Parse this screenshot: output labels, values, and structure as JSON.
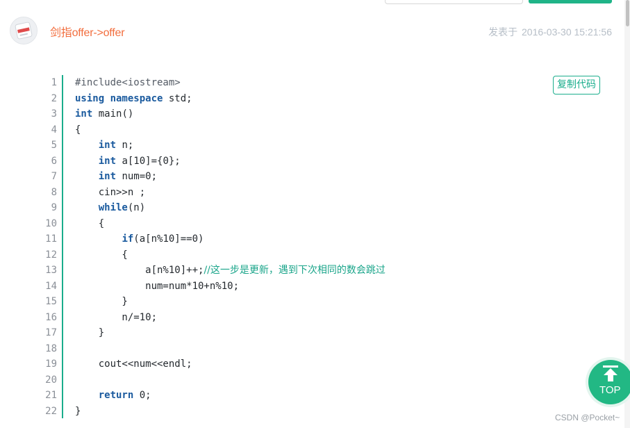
{
  "post": {
    "title": "剑指offer->offer",
    "time_prefix": "发表于",
    "timestamp": "2016-03-30 15:21:56"
  },
  "code": {
    "copy_label": "复制代码",
    "line_numbers": [
      "1",
      "2",
      "3",
      "4",
      "5",
      "6",
      "7",
      "8",
      "9",
      "10",
      "11",
      "12",
      "13",
      "14",
      "15",
      "16",
      "17",
      "18",
      "19",
      "20",
      "21",
      "22"
    ],
    "lines": [
      [
        {
          "t": "#include<iostream>",
          "c": "pp"
        }
      ],
      [
        {
          "t": "using namespace",
          "c": "kw"
        },
        {
          "t": " std;",
          "c": ""
        }
      ],
      [
        {
          "t": "int",
          "c": "kw"
        },
        {
          "t": " main()",
          "c": ""
        }
      ],
      [
        {
          "t": "{",
          "c": ""
        }
      ],
      [
        {
          "t": "    ",
          "c": ""
        },
        {
          "t": "int",
          "c": "kw"
        },
        {
          "t": " n;",
          "c": ""
        }
      ],
      [
        {
          "t": "    ",
          "c": ""
        },
        {
          "t": "int",
          "c": "kw"
        },
        {
          "t": " a[10]={0};",
          "c": ""
        }
      ],
      [
        {
          "t": "    ",
          "c": ""
        },
        {
          "t": "int",
          "c": "kw"
        },
        {
          "t": " num=0;",
          "c": ""
        }
      ],
      [
        {
          "t": "    cin>>n ;",
          "c": ""
        }
      ],
      [
        {
          "t": "    ",
          "c": ""
        },
        {
          "t": "while",
          "c": "kw"
        },
        {
          "t": "(n)",
          "c": ""
        }
      ],
      [
        {
          "t": "    {",
          "c": ""
        }
      ],
      [
        {
          "t": "        ",
          "c": ""
        },
        {
          "t": "if",
          "c": "kw"
        },
        {
          "t": "(a[n%10]==0)",
          "c": ""
        }
      ],
      [
        {
          "t": "        {",
          "c": ""
        }
      ],
      [
        {
          "t": "            a[n%10]++;",
          "c": ""
        },
        {
          "t": "//这一步是更新，遇到下次相同的数会跳过",
          "c": "cmt"
        }
      ],
      [
        {
          "t": "            num=num*10+n%10;",
          "c": ""
        }
      ],
      [
        {
          "t": "        }",
          "c": ""
        }
      ],
      [
        {
          "t": "        n/=10;",
          "c": ""
        }
      ],
      [
        {
          "t": "    }",
          "c": ""
        }
      ],
      [
        {
          "t": "",
          "c": ""
        }
      ],
      [
        {
          "t": "    cout<<num<<endl;",
          "c": ""
        }
      ],
      [
        {
          "t": "",
          "c": ""
        }
      ],
      [
        {
          "t": "    ",
          "c": ""
        },
        {
          "t": "return",
          "c": "kw"
        },
        {
          "t": " 0;",
          "c": ""
        }
      ],
      [
        {
          "t": "}",
          "c": ""
        }
      ]
    ]
  },
  "back_to_top": {
    "label": "TOP"
  },
  "watermark": "CSDN @Pocket~",
  "colors": {
    "accent": "#1aad8c",
    "title": "#f26d3d",
    "keyword": "#1a5a9e"
  },
  "icons": {
    "avatar": "avatar-image",
    "top": "arrow-up-icon"
  }
}
